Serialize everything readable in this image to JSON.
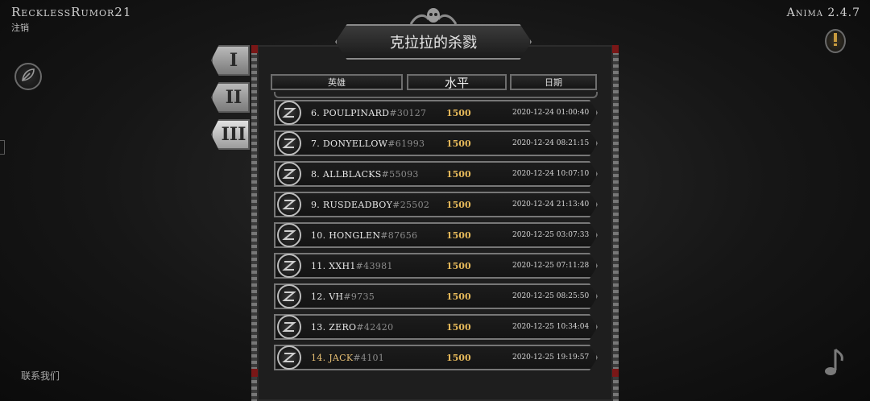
{
  "header": {
    "user_name": "RecklessRumor21",
    "logout_label": "注销",
    "version": "Anima 2.4.7"
  },
  "footer": {
    "contact_label": "联系我们"
  },
  "board": {
    "title": "克拉拉的杀戮",
    "tabs": [
      {
        "label": "I",
        "active": false
      },
      {
        "label": "II",
        "active": false
      },
      {
        "label": "III",
        "active": true
      }
    ],
    "columns": {
      "hero": "英雄",
      "level": "水平",
      "date": "日期"
    },
    "rows": [
      {
        "rank_name": "6. POULPINARD",
        "tag": "#30127",
        "level": "1500",
        "date": "2020-12-24 01:00:40"
      },
      {
        "rank_name": "7. DONYELLOW",
        "tag": "#61993",
        "level": "1500",
        "date": "2020-12-24 08:21:15"
      },
      {
        "rank_name": "8. ALLBLACKS",
        "tag": "#55093",
        "level": "1500",
        "date": "2020-12-24 10:07:10"
      },
      {
        "rank_name": "9. RUSDEADBOY",
        "tag": "#25502",
        "level": "1500",
        "date": "2020-12-24 21:13:40"
      },
      {
        "rank_name": "10. HONGLEN",
        "tag": "#87656",
        "level": "1500",
        "date": "2020-12-25 03:07:33"
      },
      {
        "rank_name": "11. XXH1",
        "tag": "#43981",
        "level": "1500",
        "date": "2020-12-25 07:11:28"
      },
      {
        "rank_name": "12. VH",
        "tag": "#9735",
        "level": "1500",
        "date": "2020-12-25 08:25:50"
      },
      {
        "rank_name": "13. ZERO",
        "tag": "#42420",
        "level": "1500",
        "date": "2020-12-25 10:34:04"
      },
      {
        "rank_name": "14. JACK",
        "tag": "#4101",
        "level": "1500",
        "date": "2020-12-25 19:19:57"
      }
    ]
  },
  "icons": {
    "leaf": "leaf-icon",
    "alert": "alert-icon",
    "music": "music-note-icon",
    "skull": "skull-ornament-icon",
    "avatar": "class-emblem-icon"
  },
  "colors": {
    "level_gold": "#e6b95a",
    "highlight_name": "#e8c074",
    "corner_red": "#7a1717"
  }
}
